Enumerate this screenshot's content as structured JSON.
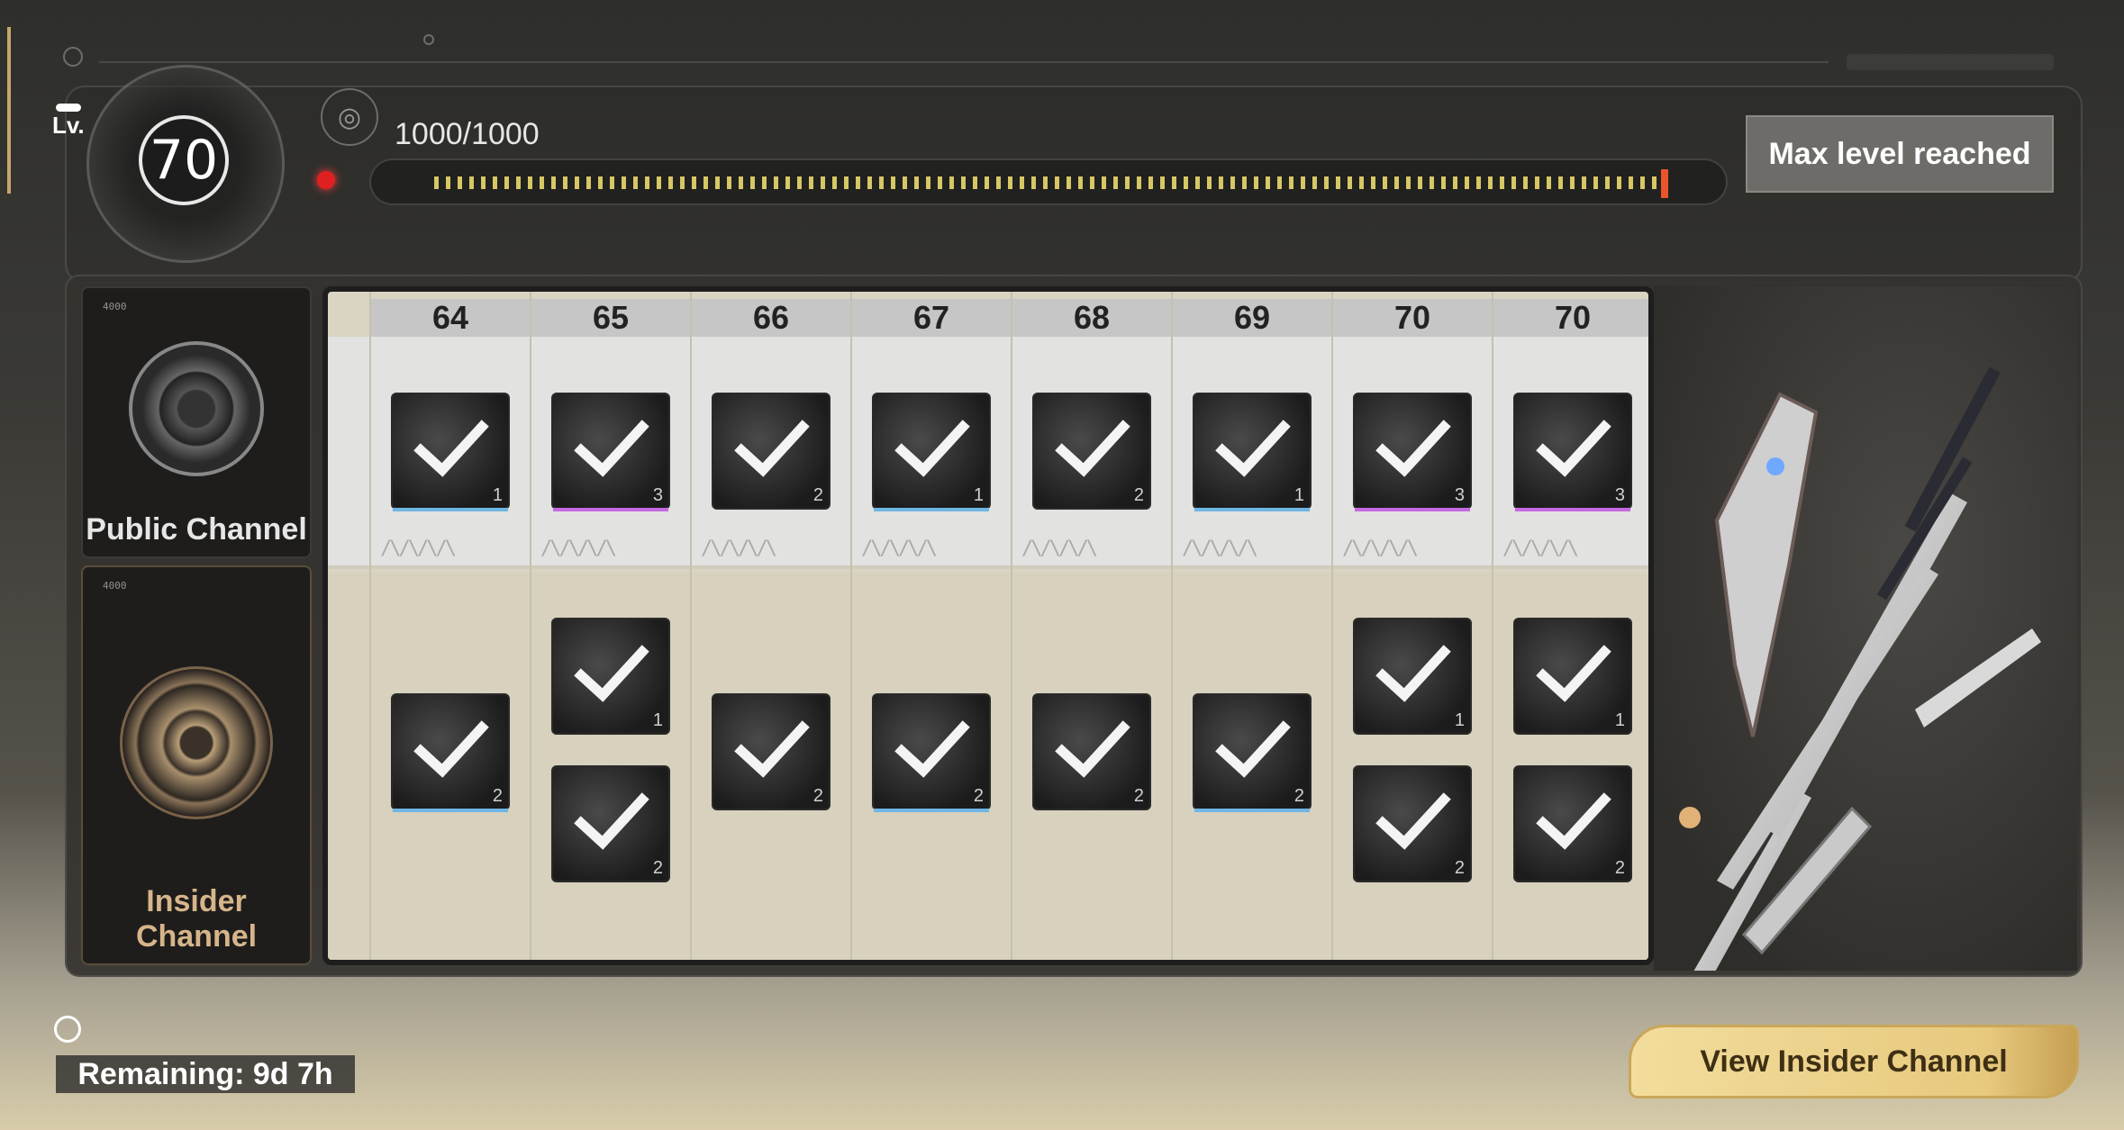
{
  "level": {
    "label": "Lv.",
    "value": "70"
  },
  "xp": {
    "text": "1000/1000",
    "progress": 1.0
  },
  "max_button": "Max level reached",
  "channels": [
    {
      "label": "Public Channel",
      "color": "#e6e6e6",
      "code": "4000"
    },
    {
      "label": "Insider Channel",
      "color": "#d6b58a",
      "code": "4000"
    }
  ],
  "columns": [
    {
      "level": "64",
      "top": {
        "count": "1",
        "rarity": "#6fb6e4"
      },
      "bottom": [
        {
          "count": "2",
          "rarity": "#6fb6e4"
        }
      ]
    },
    {
      "level": "65",
      "top": {
        "count": "3",
        "rarity": "#c46ae0"
      },
      "bottom": [
        {
          "count": "1",
          "rarity": ""
        },
        {
          "count": "2",
          "rarity": ""
        }
      ]
    },
    {
      "level": "66",
      "top": {
        "count": "2",
        "rarity": ""
      },
      "bottom": [
        {
          "count": "2",
          "rarity": ""
        }
      ]
    },
    {
      "level": "67",
      "top": {
        "count": "1",
        "rarity": "#6fb6e4"
      },
      "bottom": [
        {
          "count": "2",
          "rarity": "#6fb6e4"
        }
      ]
    },
    {
      "level": "68",
      "top": {
        "count": "2",
        "rarity": ""
      },
      "bottom": [
        {
          "count": "2",
          "rarity": ""
        }
      ]
    },
    {
      "level": "69",
      "top": {
        "count": "1",
        "rarity": "#6fb6e4"
      },
      "bottom": [
        {
          "count": "2",
          "rarity": "#6fb6e4"
        }
      ]
    },
    {
      "level": "70",
      "top": {
        "count": "3",
        "rarity": "#c46ae0"
      },
      "bottom": [
        {
          "count": "1",
          "rarity": ""
        },
        {
          "count": "2",
          "rarity": ""
        }
      ]
    },
    {
      "level": "70",
      "top": {
        "count": "3",
        "rarity": "#c46ae0"
      },
      "bottom": [
        {
          "count": "1",
          "rarity": ""
        },
        {
          "count": "2",
          "rarity": ""
        }
      ]
    }
  ],
  "view_button": "View Insider Channel",
  "remaining": "Remaining: 9d 7h"
}
